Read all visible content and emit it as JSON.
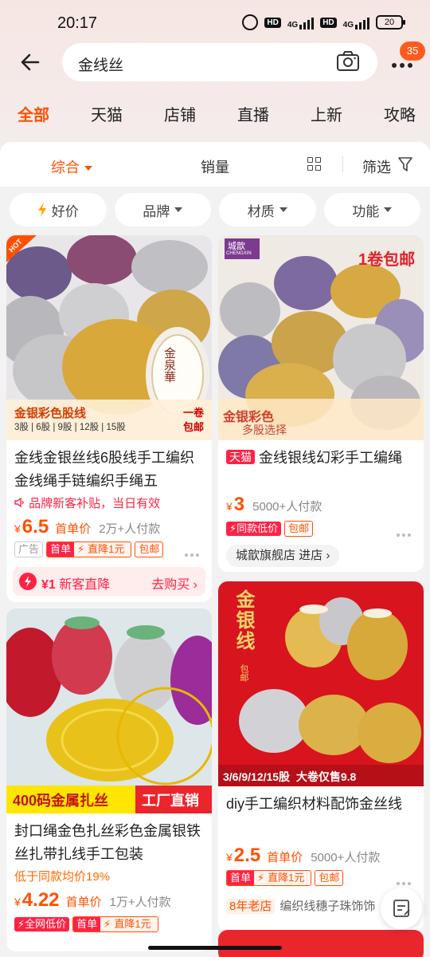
{
  "status": {
    "time": "20:17",
    "network1": "4G",
    "network2": "4G",
    "battery": "20",
    "hd": "HD"
  },
  "search": {
    "query": "金线丝",
    "badge": "35"
  },
  "tabs": [
    "全部",
    "天猫",
    "店铺",
    "直播",
    "上新",
    "攻略"
  ],
  "sort": {
    "comprehensive": "综合",
    "sales": "销量",
    "filter": "筛选"
  },
  "chips": [
    "好价",
    "品牌",
    "材质",
    "功能"
  ],
  "products": [
    {
      "title": "金线金银丝线6股线手工编织金线绳手链编织手绳五",
      "image_text": {
        "hot": "HOT",
        "brand": "金泉華",
        "banner": "金银彩色股线",
        "spec": "3股 | 6股 | 9股 | 12股 | 15股",
        "corner1": "一卷",
        "corner2": "包邮"
      },
      "note": "品牌新客补贴，当日有效",
      "price_symbol": "¥",
      "price": "6.5",
      "unit": "首单价",
      "sold": "2万+人付款",
      "tags": {
        "ad": "广告",
        "first": "首单",
        "drop": "直降1元",
        "ship": "包邮"
      },
      "promo": {
        "amount": "¥1",
        "text": "新客直降",
        "action": "去购买"
      }
    },
    {
      "title_badge": "天猫",
      "title": "金线银线幻彩手工编绳",
      "image_text": {
        "brand": "城歆",
        "brand_en": "CHENGXIN",
        "corner": "1卷包邮",
        "banner1": "金银彩色",
        "banner2": "多股选择"
      },
      "price_symbol": "¥",
      "price": "3",
      "sold": "5000+人付款",
      "tags": {
        "low": "同款低价",
        "ship": "包邮"
      },
      "store": "城歆旗舰店 进店"
    },
    {
      "title": "封口绳金色扎丝彩色金属银铁丝扎带扎线手工包装",
      "image_text": {
        "banner1": "400码金属扎丝",
        "banner2": "工厂直销"
      },
      "note": "低于同款均价19%",
      "price_symbol": "¥",
      "price": "4.22",
      "unit": "首单价",
      "sold": "1万+人付款",
      "tags": {
        "low": "全网低价",
        "first": "首单",
        "drop": "直降1元"
      }
    },
    {
      "title": "diy手工编织材料配饰金丝线",
      "image_text": {
        "vertical": "金银线",
        "sub": "包邮",
        "banner": "3/6/9/12/15股  大卷仅售9.8"
      },
      "price_symbol": "¥",
      "price": "2.5",
      "unit": "首单价",
      "sold": "5000+人付款",
      "tags": {
        "first": "首单",
        "drop": "直降1元",
        "ship": "包邮"
      },
      "shop_age": "8年老店",
      "shop_desc": "编织线穗子珠饰饰"
    }
  ],
  "colors": {
    "accent": "#ff5000",
    "red": "#ff2244",
    "gold": "#d9a52b",
    "silver": "#c9c9c9"
  }
}
